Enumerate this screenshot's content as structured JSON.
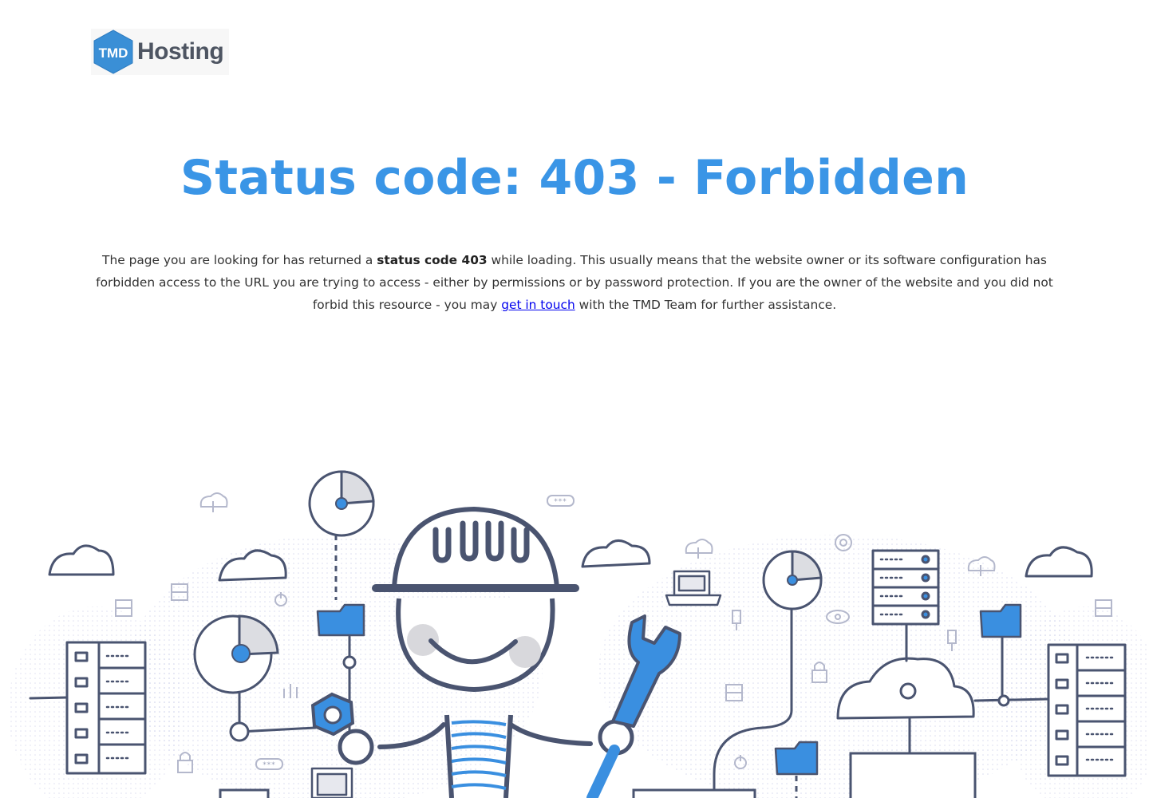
{
  "brand": {
    "logo_badge": "TMD",
    "logo_word": "Hosting",
    "badge_color": "#3a8fd6",
    "word_color": "#4e5562"
  },
  "error": {
    "title": "Status code: 403 - Forbidden",
    "intro": "The page you are looking for has returned a ",
    "code_text": "status code 403",
    "body": " while loading. This usually means that the website owner or its software configuration has forbidden access to the URL you are trying to access - either by permissions or by password protection. If you are the owner of the website and you did not forbid this resource - you may ",
    "link_text": "get in touch",
    "outro": " with the TMD Team for further assistance."
  },
  "colors": {
    "accent": "#3a95e6",
    "line": "#4a5470",
    "fill": "#3a8fe0"
  },
  "illustration": {
    "password_tags": [
      "***",
      "***"
    ]
  }
}
